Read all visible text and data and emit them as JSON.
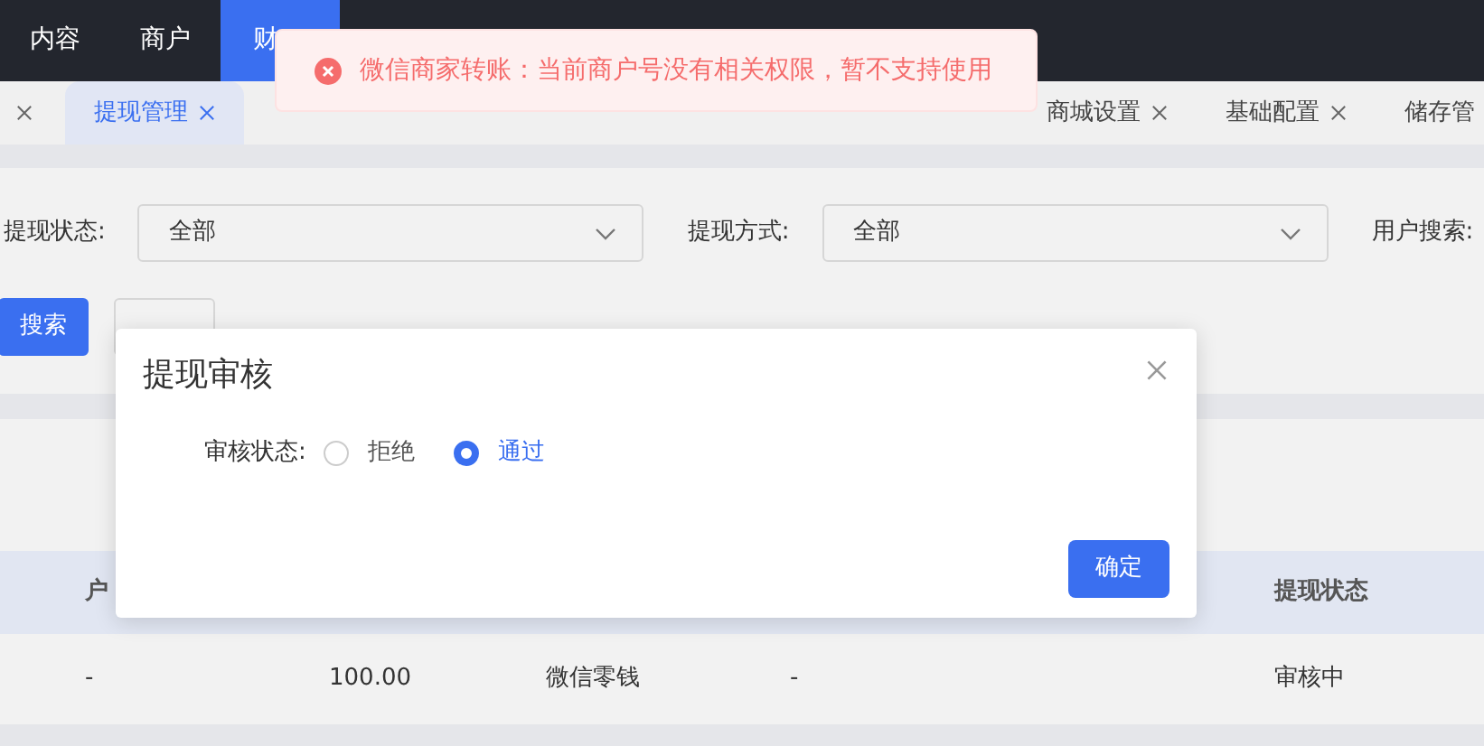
{
  "top_nav": [
    {
      "label": "内容",
      "selected": false
    },
    {
      "label": "商户",
      "selected": false
    },
    {
      "label": "财",
      "selected": true
    }
  ],
  "tabs": [
    {
      "kind": "cut",
      "selected": false,
      "closable": true
    },
    {
      "label": "提现管理",
      "selected": true,
      "closable": true
    }
  ],
  "tabs_right": [
    {
      "label": "商城设置",
      "selected": false,
      "closable": true
    },
    {
      "label": "基础配置",
      "selected": false,
      "closable": true
    },
    {
      "label": "储存管",
      "selected": false,
      "closable": false
    }
  ],
  "filters": [
    {
      "label": "提现状态:",
      "value": "全部"
    },
    {
      "label": "提现方式:",
      "value": "全部"
    },
    {
      "label": "用户搜索:"
    }
  ],
  "actions": {
    "search": "搜索"
  },
  "table": {
    "header": {
      "column_1": "户",
      "column_5": "提现状态"
    },
    "rows": [
      [
        "-",
        "100.00",
        "微信零钱",
        "-",
        "审核中"
      ]
    ]
  },
  "modal": {
    "title": "提现审核",
    "field_label": "审核状态:",
    "options": [
      {
        "label": "拒绝",
        "selected": false
      },
      {
        "label": "通过",
        "selected": true
      }
    ],
    "confirm": "确定"
  },
  "toast": {
    "message": "微信商家转账：当前商户号没有相关权限，暂不支持使用"
  }
}
